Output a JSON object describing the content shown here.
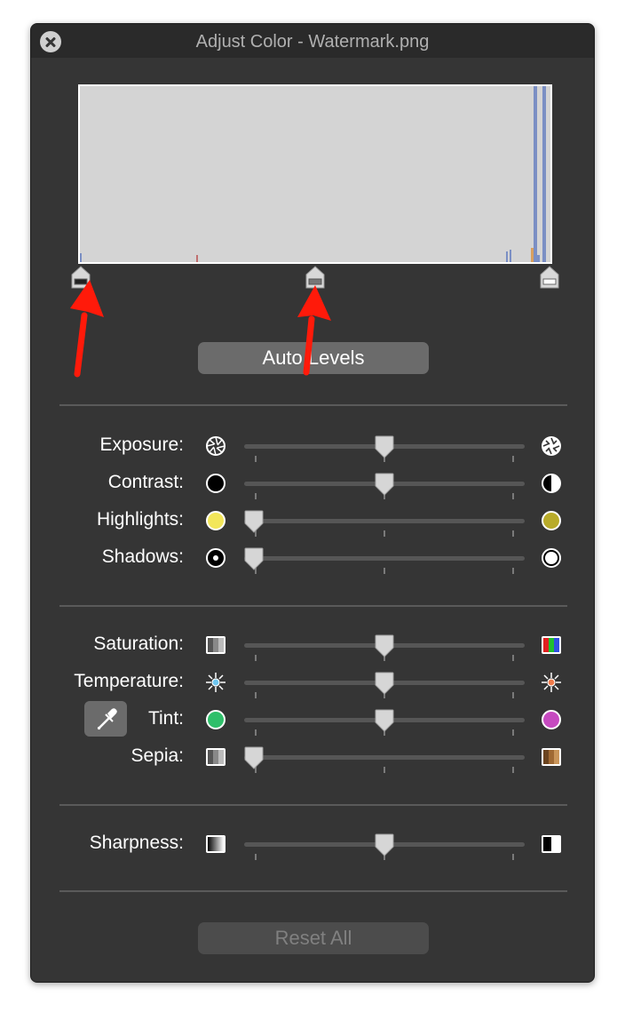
{
  "window": {
    "title": "Adjust Color - Watermark.png"
  },
  "levels": {
    "auto_label": "Auto Levels"
  },
  "colors": {
    "histogram_bg": "#d4d4d4",
    "histogram_bar": "#7b8fc4",
    "arrow": "#ff1a0a",
    "window_bg": "#353535"
  },
  "group1": [
    {
      "name": "exposure",
      "label": "Exposure:",
      "value": 0.5
    },
    {
      "name": "contrast",
      "label": "Contrast:",
      "value": 0.5
    },
    {
      "name": "highlights",
      "label": "Highlights:",
      "value": 0.0
    },
    {
      "name": "shadows",
      "label": "Shadows:",
      "value": 0.0
    }
  ],
  "group2": [
    {
      "name": "saturation",
      "label": "Saturation:",
      "value": 0.5
    },
    {
      "name": "temperature",
      "label": "Temperature:",
      "value": 0.5
    },
    {
      "name": "tint",
      "label": "Tint:",
      "value": 0.5
    },
    {
      "name": "sepia",
      "label": "Sepia:",
      "value": 0.0
    }
  ],
  "group3": [
    {
      "name": "sharpness",
      "label": "Sharpness:",
      "value": 0.5
    }
  ],
  "footer": {
    "reset_label": "Reset All"
  }
}
